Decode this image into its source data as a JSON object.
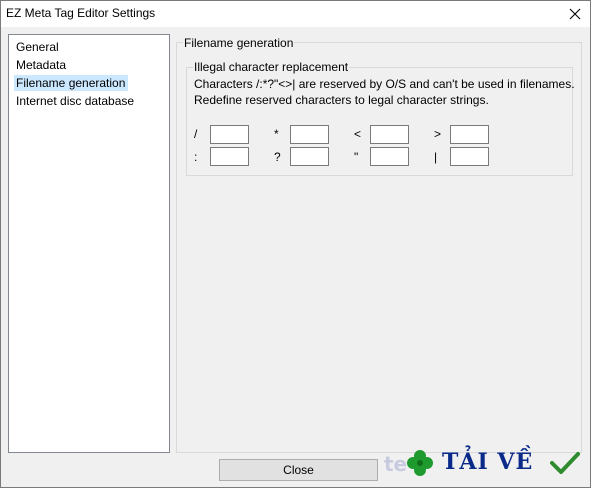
{
  "window": {
    "title": "EZ Meta Tag Editor Settings",
    "close_icon": "close-icon"
  },
  "sidebar": {
    "items": [
      {
        "label": "General",
        "selected": false
      },
      {
        "label": "Metadata",
        "selected": false
      },
      {
        "label": "Filename generation",
        "selected": true
      },
      {
        "label": "Internet disc database",
        "selected": false
      }
    ]
  },
  "panel": {
    "title": "Filename generation",
    "group": {
      "title": "Illegal character replacement",
      "line1": "Characters /:*?\"<>| are reserved by O/S and can't be used in filenames.",
      "line2": "Redefine reserved characters to legal character strings.",
      "chars": [
        {
          "char": "/",
          "value": ""
        },
        {
          "char": "*",
          "value": ""
        },
        {
          "char": "<",
          "value": ""
        },
        {
          "char": ">",
          "value": ""
        },
        {
          "char": ":",
          "value": ""
        },
        {
          "char": "?",
          "value": ""
        },
        {
          "char": "\"",
          "value": ""
        },
        {
          "char": "|",
          "value": ""
        }
      ]
    }
  },
  "footer": {
    "close_label": "Close"
  },
  "watermark": {
    "text": "TẢI VỀ"
  },
  "colors": {
    "selection": "#cce8ff",
    "watermark_text": "#0a2a8a",
    "watermark_check": "#2e8b2e",
    "watermark_leaf": "#1f9a2f"
  }
}
